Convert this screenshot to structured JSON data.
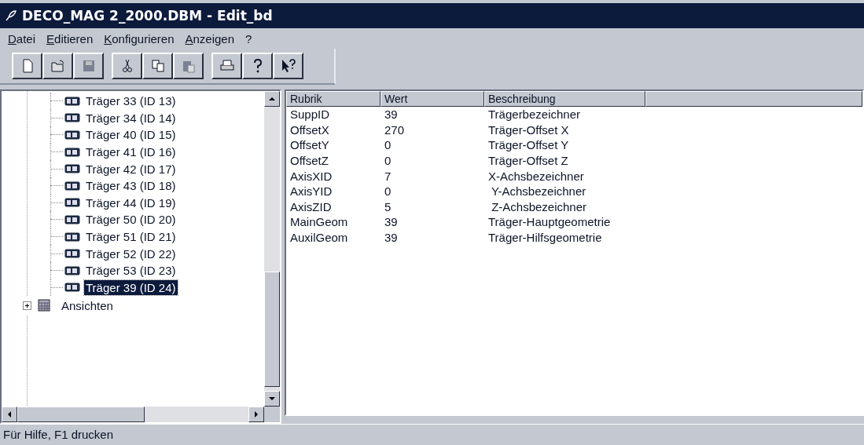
{
  "window": {
    "title": "DECO_MAG 2_2000.DBM - Edit_bd"
  },
  "menu": [
    "Datei",
    "Editieren",
    "Konfigurieren",
    "Anzeigen",
    "?"
  ],
  "toolbar": [
    [
      {
        "kind": "new",
        "disabled": false
      },
      {
        "kind": "open",
        "disabled": false
      },
      {
        "kind": "save",
        "disabled": true
      }
    ],
    [
      {
        "kind": "cut",
        "disabled": false
      },
      {
        "kind": "copy",
        "disabled": false
      },
      {
        "kind": "paste",
        "disabled": true
      }
    ],
    [
      {
        "kind": "print",
        "disabled": false
      },
      {
        "kind": "help",
        "disabled": false
      },
      {
        "kind": "context-help",
        "disabled": false
      }
    ]
  ],
  "tree": {
    "items": [
      {
        "label": "Träger 33 (ID 13)",
        "selected": false
      },
      {
        "label": "Träger 34 (ID 14)",
        "selected": false
      },
      {
        "label": "Träger 40 (ID 15)",
        "selected": false
      },
      {
        "label": "Träger 41 (ID 16)",
        "selected": false
      },
      {
        "label": "Träger 42 (ID 17)",
        "selected": false
      },
      {
        "label": "Träger 43 (ID 18)",
        "selected": false
      },
      {
        "label": "Träger 44 (ID 19)",
        "selected": false
      },
      {
        "label": "Träger 50 (ID 20)",
        "selected": false
      },
      {
        "label": "Träger 51 (ID 21)",
        "selected": false
      },
      {
        "label": "Träger 52 (ID 22)",
        "selected": false
      },
      {
        "label": "Träger 53 (ID 23)",
        "selected": false
      },
      {
        "label": "Träger 39 (ID 24)",
        "selected": true
      }
    ],
    "folders": [
      {
        "label": "Ansichten",
        "expanded": false
      }
    ]
  },
  "table": {
    "columns": [
      "Rubrik",
      "Wert",
      "Beschreibung"
    ],
    "rows": [
      [
        "SuppID",
        "39",
        "Trägerbezeichner"
      ],
      [
        "OffsetX",
        "270",
        "Träger-Offset X"
      ],
      [
        "OffsetY",
        "0",
        "Träger-Offset Y"
      ],
      [
        "OffsetZ",
        "0",
        "Träger-Offset Z"
      ],
      [
        "AxisXID",
        "7",
        "X-Achsbezeichner"
      ],
      [
        "AxisYID",
        "0",
        " Y-Achsbezeichner"
      ],
      [
        "AxisZID",
        "5",
        " Z-Achsbezeichner"
      ],
      [
        "MainGeom",
        "39",
        "Träger-Hauptgeometrie"
      ],
      [
        "AuxilGeom",
        "39",
        "Träger-Hilfsgeometrie"
      ]
    ]
  },
  "status_bar": "Für Hilfe, F1 drucken"
}
